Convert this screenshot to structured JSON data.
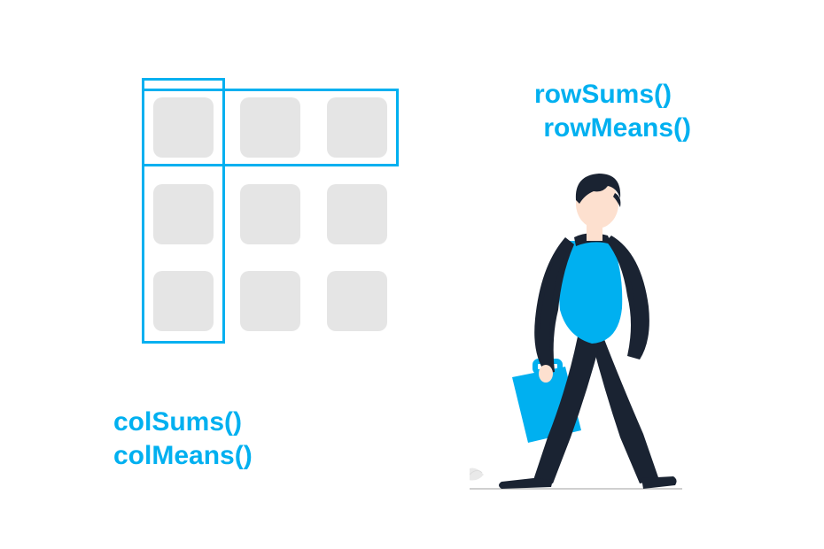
{
  "labels": {
    "rowSums": "rowSums()",
    "rowMeans": "rowMeans()",
    "colSums": "colSums()",
    "colMeans": "colMeans()"
  },
  "colors": {
    "accent": "#00b0f0",
    "cell": "#e5e5e5",
    "personDark": "#1a2332",
    "personSkin": "#fde0cf",
    "personShirt": "#00b0f0"
  },
  "grid": {
    "rows": 3,
    "cols": 3,
    "cellSize": 68,
    "cellGap": 30
  }
}
